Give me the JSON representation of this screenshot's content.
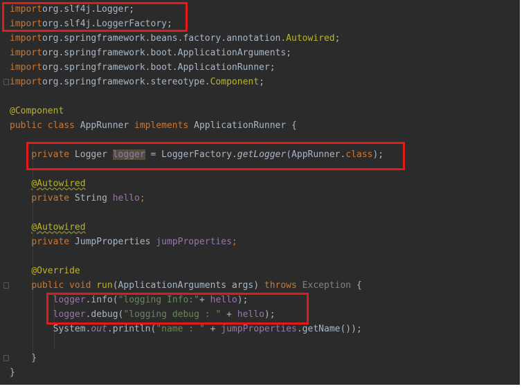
{
  "editor": {
    "lines": [
      {
        "parts": [
          [
            "kw",
            "import"
          ],
          [
            "",
            "org.slf4j.Logger;"
          ]
        ]
      },
      {
        "parts": [
          [
            "kw",
            "import"
          ],
          [
            "",
            "org.slf4j.LoggerFactory;"
          ]
        ]
      },
      {
        "parts": [
          [
            "kw",
            "import"
          ],
          [
            "",
            "org.springframework.beans.factory.annotation."
          ],
          [
            "ann",
            "Autowired"
          ],
          [
            "",
            ";"
          ]
        ]
      },
      {
        "parts": [
          [
            "kw",
            "import"
          ],
          [
            "",
            "org.springframework.boot.ApplicationArguments;"
          ]
        ]
      },
      {
        "parts": [
          [
            "kw",
            "import"
          ],
          [
            "",
            "org.springframework.boot.ApplicationRunner;"
          ]
        ]
      },
      {
        "parts": [
          [
            "kw",
            "import"
          ],
          [
            "",
            "org.springframework.stereotype."
          ],
          [
            "ann",
            "Component"
          ],
          [
            "",
            ";"
          ]
        ]
      },
      {
        "parts": []
      },
      {
        "parts": [
          [
            "ann",
            "@Component"
          ]
        ]
      },
      {
        "parts": [
          [
            "kw",
            "public class"
          ],
          [
            "",
            " AppRunner "
          ],
          [
            "kw",
            "implements"
          ],
          [
            "",
            " ApplicationRunner {"
          ]
        ]
      },
      {
        "parts": []
      },
      {
        "parts": [
          [
            "",
            "    "
          ],
          [
            "kw",
            "private"
          ],
          [
            "",
            " Logger "
          ],
          [
            "hl",
            "logger"
          ],
          [
            "",
            " = LoggerFactory."
          ],
          [
            "itl",
            "getLogger"
          ],
          [
            "",
            "(AppRunner."
          ],
          [
            "kw",
            "class"
          ],
          [
            "",
            ");"
          ]
        ]
      },
      {
        "parts": []
      },
      {
        "parts": [
          [
            "",
            "    "
          ],
          [
            "ann sq",
            "@Autowired"
          ]
        ]
      },
      {
        "parts": [
          [
            "",
            "    "
          ],
          [
            "kw",
            "private"
          ],
          [
            "",
            " String "
          ],
          [
            "fld",
            "hello"
          ],
          [
            "kw",
            ";"
          ]
        ]
      },
      {
        "parts": []
      },
      {
        "parts": [
          [
            "",
            "    "
          ],
          [
            "ann sq",
            "@Autowired"
          ]
        ]
      },
      {
        "parts": [
          [
            "",
            "    "
          ],
          [
            "kw",
            "private"
          ],
          [
            "",
            " JumpProperties "
          ],
          [
            "fld",
            "jumpProperties"
          ],
          [
            "kw",
            ";"
          ]
        ]
      },
      {
        "parts": []
      },
      {
        "parts": [
          [
            "",
            "    "
          ],
          [
            "ann",
            "@Override"
          ]
        ]
      },
      {
        "parts": [
          [
            "",
            "    "
          ],
          [
            "kw",
            "public void"
          ],
          [
            "",
            " "
          ],
          [
            "ann",
            "run"
          ],
          [
            "",
            "(ApplicationArguments args) "
          ],
          [
            "kw",
            "throws"
          ],
          [
            "",
            " "
          ],
          [
            "excl",
            "Exception"
          ],
          [
            "",
            " {"
          ]
        ]
      },
      {
        "parts": [
          [
            "",
            "        "
          ],
          [
            "fld",
            "logger"
          ],
          [
            "",
            ".info("
          ],
          [
            "str",
            "\"logging Info:\""
          ],
          [
            "",
            "+ "
          ],
          [
            "fld",
            "hello"
          ],
          [
            "",
            ");"
          ]
        ]
      },
      {
        "parts": [
          [
            "",
            "        "
          ],
          [
            "fld",
            "logger"
          ],
          [
            "",
            ".debug("
          ],
          [
            "str",
            "\"logging debug : \""
          ],
          [
            "",
            " + "
          ],
          [
            "fld",
            "hello"
          ],
          [
            "",
            ");"
          ]
        ]
      },
      {
        "parts": [
          [
            "",
            "        System."
          ],
          [
            "fld itl",
            "out"
          ],
          [
            "",
            ".println("
          ],
          [
            "str",
            "\"name : \""
          ],
          [
            "",
            " + "
          ],
          [
            "fld",
            "jumpProperties"
          ],
          [
            "",
            ".getName());"
          ]
        ]
      },
      {
        "parts": []
      },
      {
        "parts": [
          [
            "",
            "    }"
          ]
        ]
      },
      {
        "parts": [
          [
            "",
            "}"
          ]
        ]
      }
    ]
  }
}
